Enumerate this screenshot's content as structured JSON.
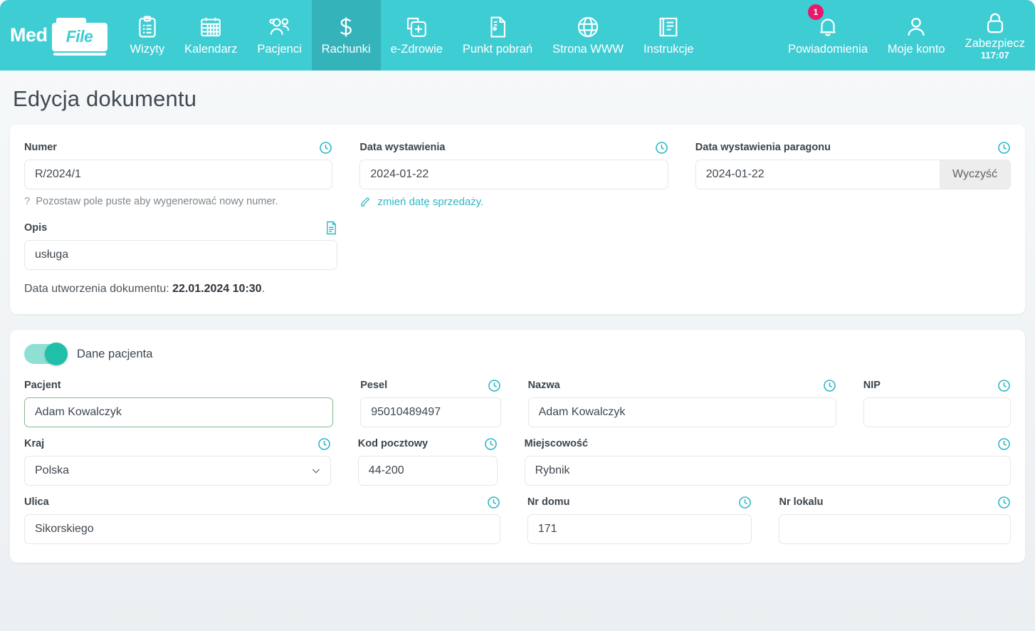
{
  "brand": {
    "med": "Med",
    "file": "File"
  },
  "nav": {
    "items": [
      {
        "label": "Wizyty",
        "icon": "clipboard-icon",
        "active": false
      },
      {
        "label": "Kalendarz",
        "icon": "calendar-icon",
        "active": false
      },
      {
        "label": "Pacjenci",
        "icon": "users-icon",
        "active": false
      },
      {
        "label": "Rachunki",
        "icon": "dollar-icon",
        "active": true
      },
      {
        "label": "e-Zdrowie",
        "icon": "health-file-icon",
        "active": false
      },
      {
        "label": "Punkt pobrań",
        "icon": "document-icon",
        "active": false
      },
      {
        "label": "Strona WWW",
        "icon": "globe-icon",
        "active": false
      },
      {
        "label": "Instrukcje",
        "icon": "book-icon",
        "active": false
      }
    ],
    "right": [
      {
        "label": "Powiadomienia",
        "icon": "bell-icon",
        "badge": "1",
        "sub": ""
      },
      {
        "label": "Moje konto",
        "icon": "user-icon",
        "badge": "",
        "sub": ""
      },
      {
        "label": "Zabezpiecz",
        "icon": "lock-icon",
        "badge": "",
        "sub": "117:07"
      }
    ]
  },
  "page": {
    "title": "Edycja dokumentu"
  },
  "document_card": {
    "numer": {
      "label": "Numer",
      "value": "R/2024/1",
      "hint_marker": "?",
      "hint": "Pozostaw pole puste aby wygenerować nowy numer."
    },
    "data_wystawienia": {
      "label": "Data wystawienia",
      "value": "2024-01-22",
      "link": "zmień datę sprzedaży."
    },
    "data_paragonu": {
      "label": "Data wystawienia paragonu",
      "value": "2024-01-22",
      "clear_label": "Wyczyść"
    },
    "opis": {
      "label": "Opis",
      "value": "usługa"
    },
    "created": {
      "prefix": "Data utworzenia dokumentu: ",
      "value": "22.01.2024 10:30",
      "suffix": "."
    }
  },
  "patient_card": {
    "toggle_label": "Dane pacjenta",
    "toggle_on": true,
    "fields": {
      "pacjent": {
        "label": "Pacjent",
        "value": "Adam Kowalczyk"
      },
      "pesel": {
        "label": "Pesel",
        "value": "95010489497"
      },
      "nazwa": {
        "label": "Nazwa",
        "value": "Adam Kowalczyk"
      },
      "nip": {
        "label": "NIP",
        "value": ""
      },
      "kraj": {
        "label": "Kraj",
        "value": "Polska"
      },
      "kod": {
        "label": "Kod pocztowy",
        "value": "44-200"
      },
      "miejsc": {
        "label": "Miejscowość",
        "value": "Rybnik"
      },
      "ulica": {
        "label": "Ulica",
        "value": "Sikorskiego"
      },
      "nr_domu": {
        "label": "Nr domu",
        "value": "171"
      },
      "nr_lokalu": {
        "label": "Nr lokalu",
        "value": ""
      }
    }
  },
  "colors": {
    "navbar": "#3fcdd4",
    "navbar_active": "#35b3bb",
    "accent": "#2fb6c4",
    "badge": "#e8186c",
    "toggle_on": "#20bfa9",
    "valid_border": "#81b98e"
  }
}
